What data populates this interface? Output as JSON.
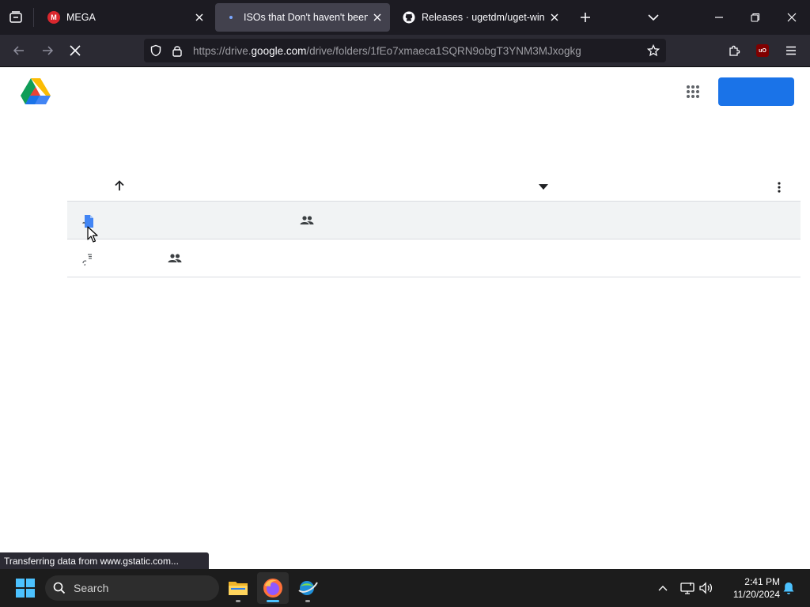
{
  "browser": {
    "tabs": [
      {
        "title": "MEGA",
        "favicon": "mega-logo-icon",
        "active": false
      },
      {
        "title": "ISOs that Don't haven't been up",
        "favicon": "loading-dot-icon",
        "active": true
      },
      {
        "title": "Releases · ugetdm/uget-windo",
        "favicon": "github-icon",
        "active": false
      }
    ],
    "url": {
      "prefix": "https://drive.",
      "domain": "google.com",
      "path": "/drive/folders/1fEo7xmaeca1SQRN9obgT3YNM3MJxogkg"
    },
    "status_text": "Transferring data from www.gstatic.com..."
  },
  "drive": {
    "signin_label": "",
    "rows": [
      {
        "name": "",
        "owner": "",
        "file_icon": "doc-file-icon",
        "shared_icon": "shared-people-icon",
        "selected": true
      },
      {
        "name": "",
        "owner": "",
        "file_icon": "loading-file-icon",
        "shared_icon": "shared-people-icon",
        "selected": false
      }
    ]
  },
  "taskbar": {
    "search_placeholder": "Search",
    "time": "2:41 PM",
    "date": "11/20/2024",
    "apps": [
      "file-explorer-icon",
      "firefox-icon",
      "network-app-icon"
    ]
  },
  "colors": {
    "tab_strip": "#1c1b22",
    "toolbar": "#2b2a33",
    "drive_blue": "#1a73e8",
    "row_selected": "#f1f3f4",
    "taskbar": "#1c1c1c"
  }
}
